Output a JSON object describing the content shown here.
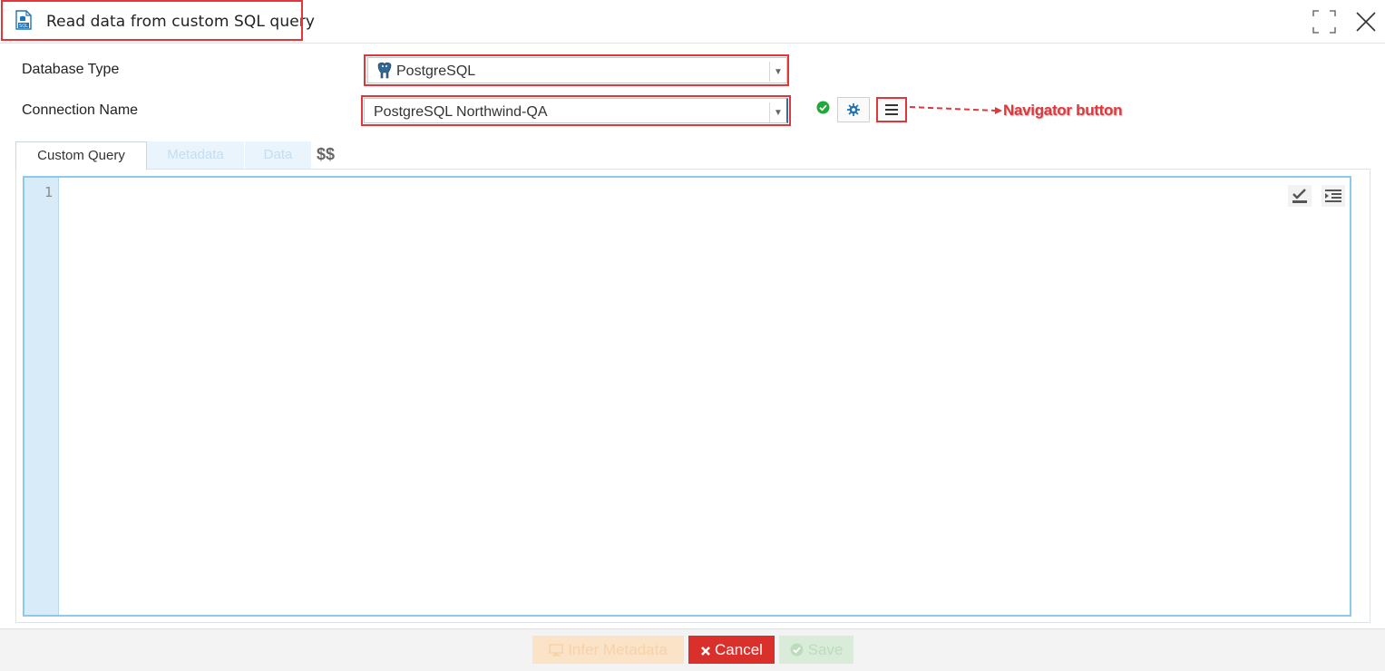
{
  "dialog": {
    "title": "Read data from custom SQL query",
    "title_icon": "sql-file-icon"
  },
  "form": {
    "database_type_label": "Database Type",
    "database_type_value": "PostgreSQL",
    "connection_name_label": "Connection Name",
    "connection_name_value": "PostgreSQL Northwind-QA"
  },
  "annotation": {
    "navigator_label": "Navigator button"
  },
  "tabs": [
    {
      "label": "Custom Query",
      "state": "active"
    },
    {
      "label": "Metadata",
      "state": "disabled"
    },
    {
      "label": "Data",
      "state": "disabled"
    }
  ],
  "parameters_symbol": "$$",
  "editor": {
    "line_numbers": [
      "1"
    ],
    "content": ""
  },
  "footer": {
    "infer_label": "Infer Metadata",
    "cancel_label": "Cancel",
    "save_label": "Save"
  },
  "colors": {
    "highlight": "#e0363c",
    "cancel": "#d9302c",
    "accent_blue": "#1f73b7",
    "ok_green": "#22a83a"
  }
}
